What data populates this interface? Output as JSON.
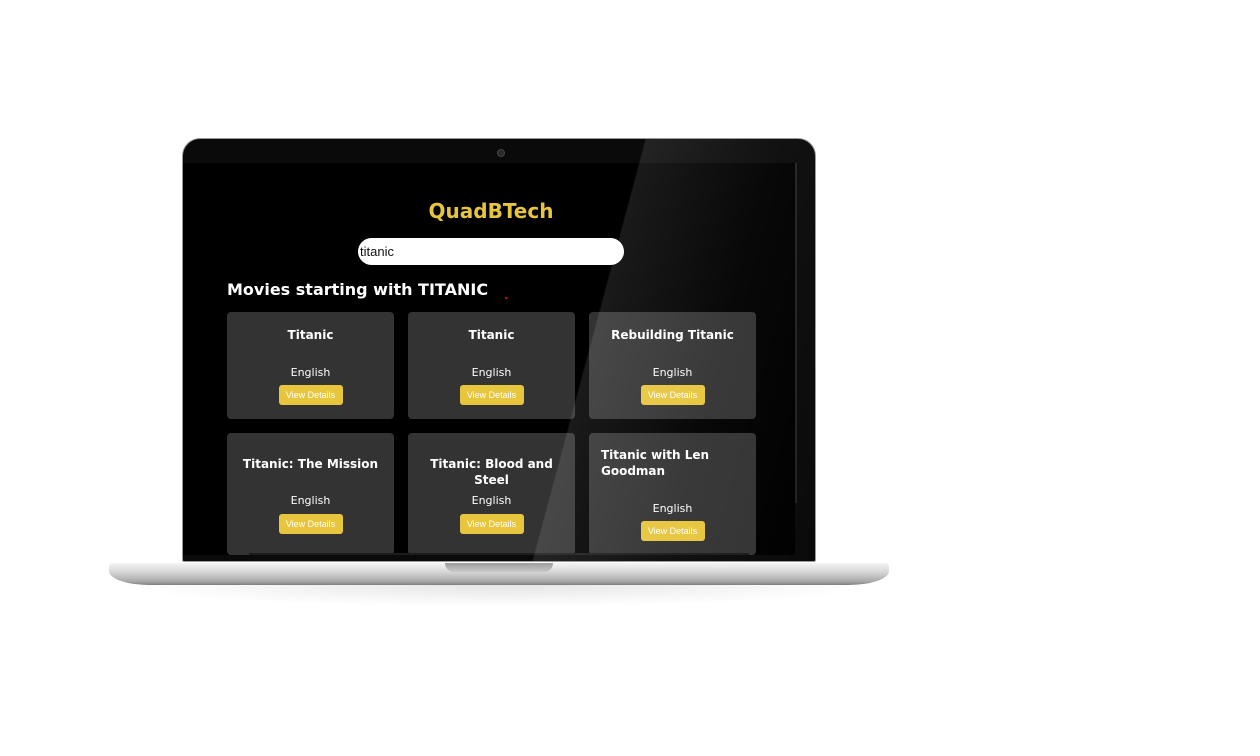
{
  "app": {
    "title": "QuadBTech"
  },
  "search": {
    "value": "titanic",
    "placeholder": ""
  },
  "results": {
    "heading": "Movies starting with TITANIC",
    "movies": [
      {
        "title": "Titanic",
        "language": "English",
        "button": "View Details"
      },
      {
        "title": "Titanic",
        "language": "English",
        "button": "View Details"
      },
      {
        "title": "Rebuilding Titanic",
        "language": "English",
        "button": "View Details"
      },
      {
        "title": "Titanic: The Mission",
        "language": "English",
        "button": "View Details"
      },
      {
        "title": "Titanic: Blood and Steel",
        "language": "English",
        "button": "View Details"
      },
      {
        "title": "Titanic with Len Goodman",
        "language": "English",
        "button": "View Details"
      }
    ]
  },
  "colors": {
    "accent": "#e7c53c",
    "background": "#000000",
    "card": "#333333"
  }
}
